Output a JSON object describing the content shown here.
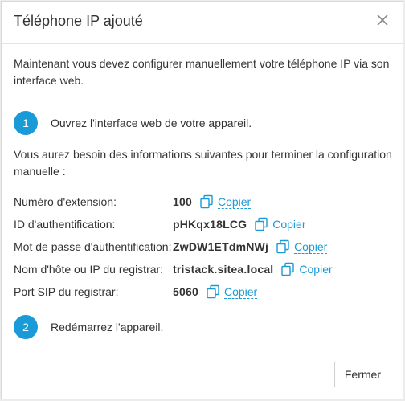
{
  "dialog": {
    "title": "Téléphone IP ajouté",
    "intro": "Maintenant vous devez configurer manuellement votre téléphone IP via son interface web.",
    "step1": {
      "number": "1",
      "text": "Ouvrez l'interface web de votre appareil."
    },
    "info": "Vous aurez besoin des informations suivantes pour terminer la configuration manuelle :",
    "rows": [
      {
        "label": "Numéro d'extension:",
        "value": "100",
        "copy": "Copier"
      },
      {
        "label": "ID d'authentification:",
        "value": "pHKqx18LCG",
        "copy": "Copier"
      },
      {
        "label": "Mot de passe d'authentification:",
        "value": "ZwDW1ETdmNWj",
        "copy": "Copier"
      },
      {
        "label": "Nom d'hôte ou IP du registrar:",
        "value": "tristack.sitea.local",
        "copy": "Copier"
      },
      {
        "label": "Port SIP du registrar:",
        "value": "5060",
        "copy": "Copier"
      }
    ],
    "step2": {
      "number": "2",
      "text": "Redémarrez l'appareil."
    },
    "close_button": "Fermer"
  },
  "colors": {
    "accent": "#1a9ad6",
    "text": "#333333",
    "border": "#e3e3e3"
  },
  "icons": {
    "close": "close-icon",
    "copy": "copy-icon"
  }
}
